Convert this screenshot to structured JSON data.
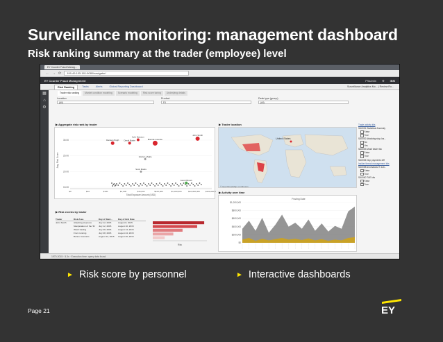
{
  "slide": {
    "title": "Surveillance monitoring: management dashboard",
    "subtitle": "Risk ranking summary at the trader (employee) level",
    "bullets": [
      "Risk score by personnel",
      "Interactive dashboards"
    ],
    "page_label": "Page 21",
    "logo": "EY"
  },
  "browser": {
    "tab_title": "EY Counter Fraud Manag...",
    "address": "199.49.105.181:9080/navigator/"
  },
  "app": {
    "brand": "EY Counter Fraud Management",
    "user": "P9admin",
    "vendor": "IBM",
    "tabs": [
      "Risk Ranking",
      "Tasks",
      "Alerts",
      "Global Reporting Dashboard"
    ],
    "breadcrumb": "Surveillance Analytics Mo... | Review Ro...",
    "subtabs": [
      "Trader risk ranking",
      "Market condition modeling",
      "Scenario modeling",
      "Risk score tuning",
      "Underlying details"
    ],
    "filters": {
      "location_label": "Location",
      "location_value": "(All)",
      "product_label": "Product",
      "product_value": "FX",
      "desk_label": "Desk type (group)",
      "desk_value": "(All)"
    },
    "panels": {
      "risk_rank": "Aggregate risk rank by trader",
      "trader_location": "Trader location",
      "activity": "Activity over time",
      "risk_events": "Risk events by trader"
    },
    "scatter": {
      "ylabel": "Avg. Risk Score",
      "xlabel": "Total Exposure Amount (USD)",
      "yticks": [
        "30.00",
        "25.00",
        "20.00",
        "15.00"
      ],
      "xticks": [
        "$0",
        "$10",
        "$100",
        "$1,000",
        "$10,000",
        "$100,000",
        "$1,000,000",
        "$10,000,000",
        "$100,000,000"
      ],
      "points": [
        {
          "label": "Kyle Dawson",
          "x": 0.48,
          "y": 0.86,
          "r": 2,
          "color": "#d9262e"
        },
        {
          "label": "Damien Pugh",
          "x": 0.3,
          "y": 0.8,
          "r": 2.5,
          "color": "#d9262e"
        },
        {
          "label": "David Burke",
          "x": 0.42,
          "y": 0.8,
          "r": 2,
          "color": "#d9262e"
        },
        {
          "label": "Brenda Lucente",
          "x": 0.6,
          "y": 0.8,
          "r": 3.5,
          "color": "#d9262e"
        },
        {
          "label": "John Smith",
          "x": 0.9,
          "y": 0.88,
          "r": 3,
          "color": "#d9262e"
        },
        {
          "label": "Gloria LaSalle",
          "x": 0.53,
          "y": 0.52,
          "r": 1.5,
          "color": "#999999"
        },
        {
          "label": "Scott Marks",
          "x": 0.5,
          "y": 0.3,
          "r": 1.5,
          "color": "#999999"
        },
        {
          "label": "Jacob Brown",
          "x": 0.82,
          "y": 0.1,
          "r": 2,
          "color": "#4aa84a"
        }
      ]
    },
    "map_label": "United States",
    "map_credit": "© OpenStreetMap contributors",
    "activity_chart": {
      "legend_title": "Posting Date",
      "yticks": [
        "$1,000,000",
        "$800,000",
        "$600,000",
        "$400,000",
        "$200,000",
        "$0"
      ],
      "grey_series": [
        0.35,
        0.55,
        0.3,
        0.62,
        0.25,
        0.45,
        0.7,
        0.4,
        0.5,
        0.35,
        0.58,
        0.3,
        0.48,
        0.28,
        0.42,
        0.35,
        0.78,
        0.9
      ],
      "gold_series": [
        0.08,
        0.12,
        0.05,
        0.1,
        0.06,
        0.09,
        0.12,
        0.08,
        0.1,
        0.07,
        0.11,
        0.06,
        0.09,
        0.05,
        0.08,
        0.06,
        0.12,
        0.14
      ]
    },
    "events": {
      "headers": [
        "Trader",
        "Risk Area",
        "Day of Start...",
        "Day of End Date"
      ],
      "rows": [
        [
          "John Smith",
          "Attacking stop-loss",
          "July 12, 2015",
          "August 8, 2015"
        ],
        [
          "",
          "Manipulation of the 'fix'",
          "July 12, 2015",
          "August 10, 2015"
        ],
        [
          "",
          "Wash trading",
          "July 28, 2015",
          "August 14, 2015"
        ],
        [
          "",
          "Front running",
          "July 28, 2015",
          "August 24, 2015"
        ],
        [
          "",
          "Banner scenario",
          "August 12, 2015",
          "August 30, 2015"
        ]
      ],
      "bars": [
        0.95,
        0.82,
        0.55,
        0.38,
        0.22
      ],
      "bar_colors": [
        "#b8282e",
        "#d4484d",
        "#e07b7e",
        "#eaa5a7",
        "#f2caca"
      ],
      "xlabel": "Risk"
    },
    "filter_list": {
      "g1": "Trade activity kits",
      "i1": "SA0051 Statistical Anomaly",
      "i2": "SA0052 Attacking stop-los...",
      "i3": "SA0053 Mosti trade risk",
      "i4": "SA0054 Dup payments diff",
      "g2": "Insider thread management kits",
      "i5": "SA0058 Anomalous IT acti...",
      "i6": "SA0060 T&E kits",
      "opt_false": "False",
      "opt_true": "True",
      "opt_no": "No",
      "opt_yes": "Yes"
    },
    "status": "1970-2015 · 5.3x · Execution time: query data found"
  },
  "colors": {
    "slide_bg": "#333333",
    "accent_yellow": "#ffe600",
    "risk_red": "#d9262e",
    "activity_grey": "#8a8a8a",
    "activity_gold": "#c9a227"
  }
}
